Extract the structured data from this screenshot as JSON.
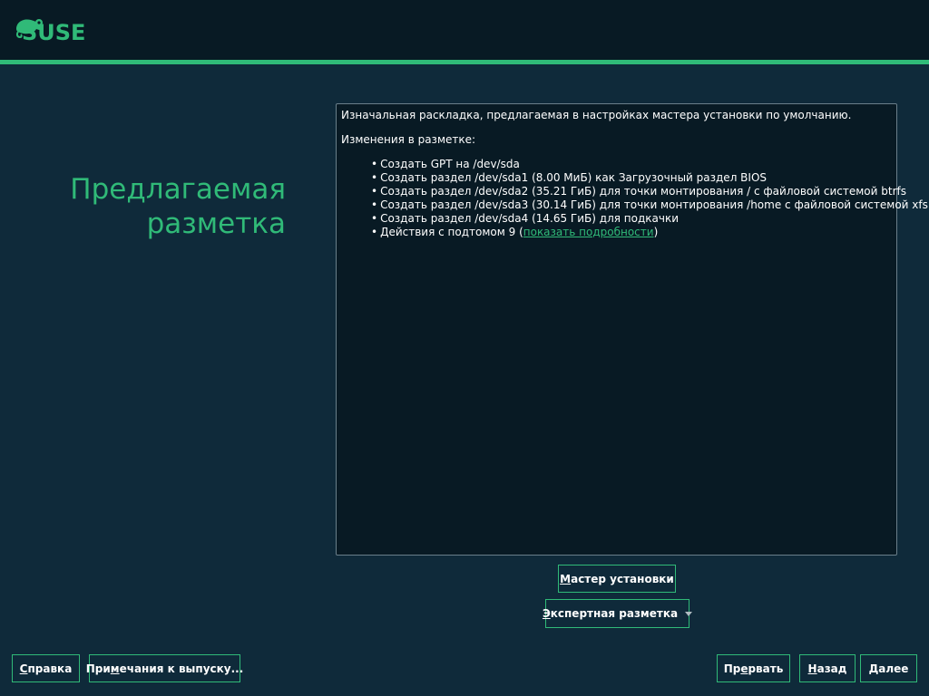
{
  "header": {
    "logo_text": "SUSE",
    "logo_icon": "chameleon-icon",
    "accent_color": "#30ba78"
  },
  "page": {
    "title_line1": "Предлагаемая",
    "title_line2": "разметка"
  },
  "summary": {
    "intro": "Изначальная раскладка, предлагаемая в настройках мастера установки по умолчанию.",
    "changes_heading": "Изменения в разметке:",
    "items": [
      "Создать GPT на /dev/sda",
      "Создать раздел /dev/sda1 (8.00 МиБ) как Загрузочный раздел BIOS",
      "Создать раздел /dev/sda2 (35.21 ГиБ) для точки монтирования / с файловой системой btrfs",
      "Создать раздел /dev/sda3 (30.14 ГиБ) для точки монтирования /home с файловой системой xfs",
      "Создать раздел /dev/sda4 (14.65 ГиБ) для подкачки"
    ],
    "more_prefix": "Действия с подтомом 9 (",
    "more_link": "показать подробности",
    "more_suffix": ")"
  },
  "actions": {
    "guided_setup": {
      "hotkey": "М",
      "rest": "астер установки"
    },
    "expert_partitioner": {
      "hotkey": "Э",
      "rest": "кспертная разметка"
    }
  },
  "footer": {
    "help": {
      "hotkey": "С",
      "rest": "правка"
    },
    "release_notes": {
      "before": "При",
      "hotkey": "м",
      "rest": "ечания к выпуску..."
    },
    "abort": {
      "before": "Пр",
      "hotkey": "е",
      "rest": "рвать"
    },
    "back": {
      "hotkey": "Н",
      "rest": "азад"
    },
    "next": {
      "hotkey": "Д",
      "rest": "алее"
    }
  }
}
